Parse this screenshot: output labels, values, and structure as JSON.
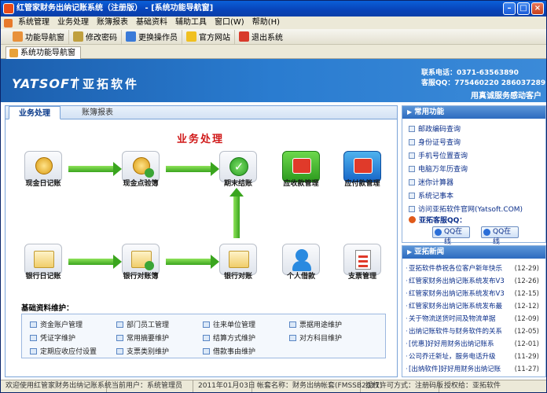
{
  "window": {
    "title": "红管家财务出纳记账系统（注册版） - [系统功能导航窗]"
  },
  "menu": [
    "系统管理",
    "业务处理",
    "账簿报表",
    "基础资料",
    "辅助工具",
    "窗口(W)",
    "帮助(H)"
  ],
  "toolbar": [
    "功能导航窗",
    "修改密码",
    "更换操作员",
    "官方网站",
    "退出系统"
  ],
  "doc_tab": "系统功能导航窗",
  "banner": {
    "logo_en": "YATSOFT",
    "logo_cn": "亚拓软件",
    "phone": "联系电话：0371-63563890",
    "qq": "客服QQ：775460220  286037289",
    "slogan": "用真诚服务感动客户"
  },
  "tabs": [
    "业务处理",
    "账簿报表"
  ],
  "flow": {
    "title": "业务处理",
    "nodes": [
      "现金日记账",
      "现金点验簿",
      "期末结账",
      "应收款管理",
      "应付款管理",
      "银行日记账",
      "银行对账簿",
      "银行对账",
      "个人借款",
      "支票管理"
    ]
  },
  "basic": {
    "title": "基础资料维护：",
    "items": [
      "资金账户管理",
      "部门员工管理",
      "往来单位管理",
      "票据用途维护",
      "凭证字维护",
      "常用摘要维护",
      "结算方式维护",
      "对方科目维护",
      "定期应收应付设置",
      "支票类别维护",
      "借款事由维护"
    ]
  },
  "common": {
    "header": "常用功能",
    "links": [
      "邮政编码查询",
      "身份证号查询",
      "手机号位置查询",
      "电脑万年历查询",
      "迷你计算器",
      "系统记事本",
      "访问亚拓软件官网(Yatsoft.COM)"
    ],
    "qq_label": "亚拓客服QQ：",
    "qq_btn1": "QQ在线",
    "qq_btn2": "QQ在线"
  },
  "news": {
    "header": "亚拓新闻",
    "items": [
      {
        "title": "亚拓软件恭祝各位客户新年快乐",
        "date": "(12-29)"
      },
      {
        "title": "红管家财务出纳记账系统发布V3",
        "date": "(12-26)"
      },
      {
        "title": "红管家财务出纳记账系统发布V3",
        "date": "(12-15)"
      },
      {
        "title": "红管家财务出纳记账系统发布最",
        "date": "(12-12)"
      },
      {
        "title": "关于物流送货时间及物流单据",
        "date": "(12-09)"
      },
      {
        "title": "出纳记账软件与财务软件的关系",
        "date": "(12-05)"
      },
      {
        "title": "[优惠]好好用财务出纳记账系",
        "date": "(12-01)"
      },
      {
        "title": "公司乔迁新址，服务电话升级",
        "date": "(11-29)"
      },
      {
        "title": "[出纳软件]好好用财务出纳记账",
        "date": "(11-27)"
      }
    ]
  },
  "status": [
    "欢迎使用红管家财务出纳记账系统",
    "当前用户：系统管理员",
    "2011年01月03日",
    "帐套名称：财务出纳帐套(FMSSB2011)",
    "授权许可方式：注册码版",
    "授权给：亚拓软件"
  ],
  "colors": {
    "title_bar": "#0843b8",
    "banner": "#2a7cd0",
    "flow_title": "#d01818",
    "arrow": "#3aa51e"
  }
}
